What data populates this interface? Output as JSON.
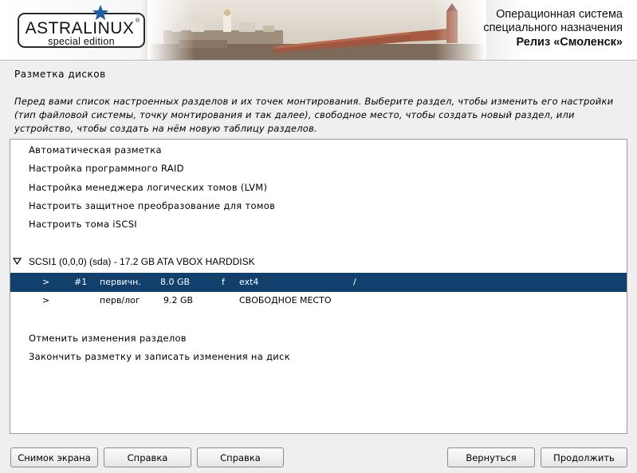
{
  "header": {
    "logo_name": "ASTRALINUX",
    "logo_reg": "®",
    "logo_edition": "special edition",
    "os_line1": "Операционная система",
    "os_line2": "специального назначения",
    "os_release": "Релиз «Смоленск»"
  },
  "page": {
    "title": "Разметка дисков",
    "description": "Перед вами список настроенных разделов и их точек монтирования. Выберите раздел, чтобы изменить его настройки (тип файловой системы, точку монтирования и так далее), свободное место, чтобы создать новый раздел, или устройство, чтобы создать на нём новую таблицу разделов."
  },
  "list": {
    "menu_items": [
      "Автоматическая разметка",
      "Настройка программного RAID",
      "Настройка менеджера логических томов (LVM)",
      "Настроить защитное преобразование для томов",
      "Настроить тома iSCSI"
    ],
    "disk": "SCSI1 (0,0,0) (sda) - 17.2 GB ATA VBOX HARDDISK",
    "partitions": [
      {
        "arrow": ">",
        "number": "#1",
        "type": "первичн.",
        "size": "8.0 GB",
        "flag": "f",
        "fs": "ext4",
        "mount": "/"
      },
      {
        "arrow": ">",
        "number": "",
        "type": "перв/лог",
        "size": "9.2 GB",
        "flag": "",
        "fs": "СВОБОДНОЕ МЕСТО",
        "mount": ""
      }
    ],
    "actions": [
      "Отменить изменения разделов",
      "Закончить разметку и записать изменения на диск"
    ]
  },
  "buttons": {
    "screenshot": "Снимок экрана",
    "help1": "Справка",
    "help2": "Справка",
    "back": "Вернуться",
    "continue": "Продолжить"
  },
  "colors": {
    "selection": "#10406b",
    "logo_star": "#1f5fa8"
  }
}
